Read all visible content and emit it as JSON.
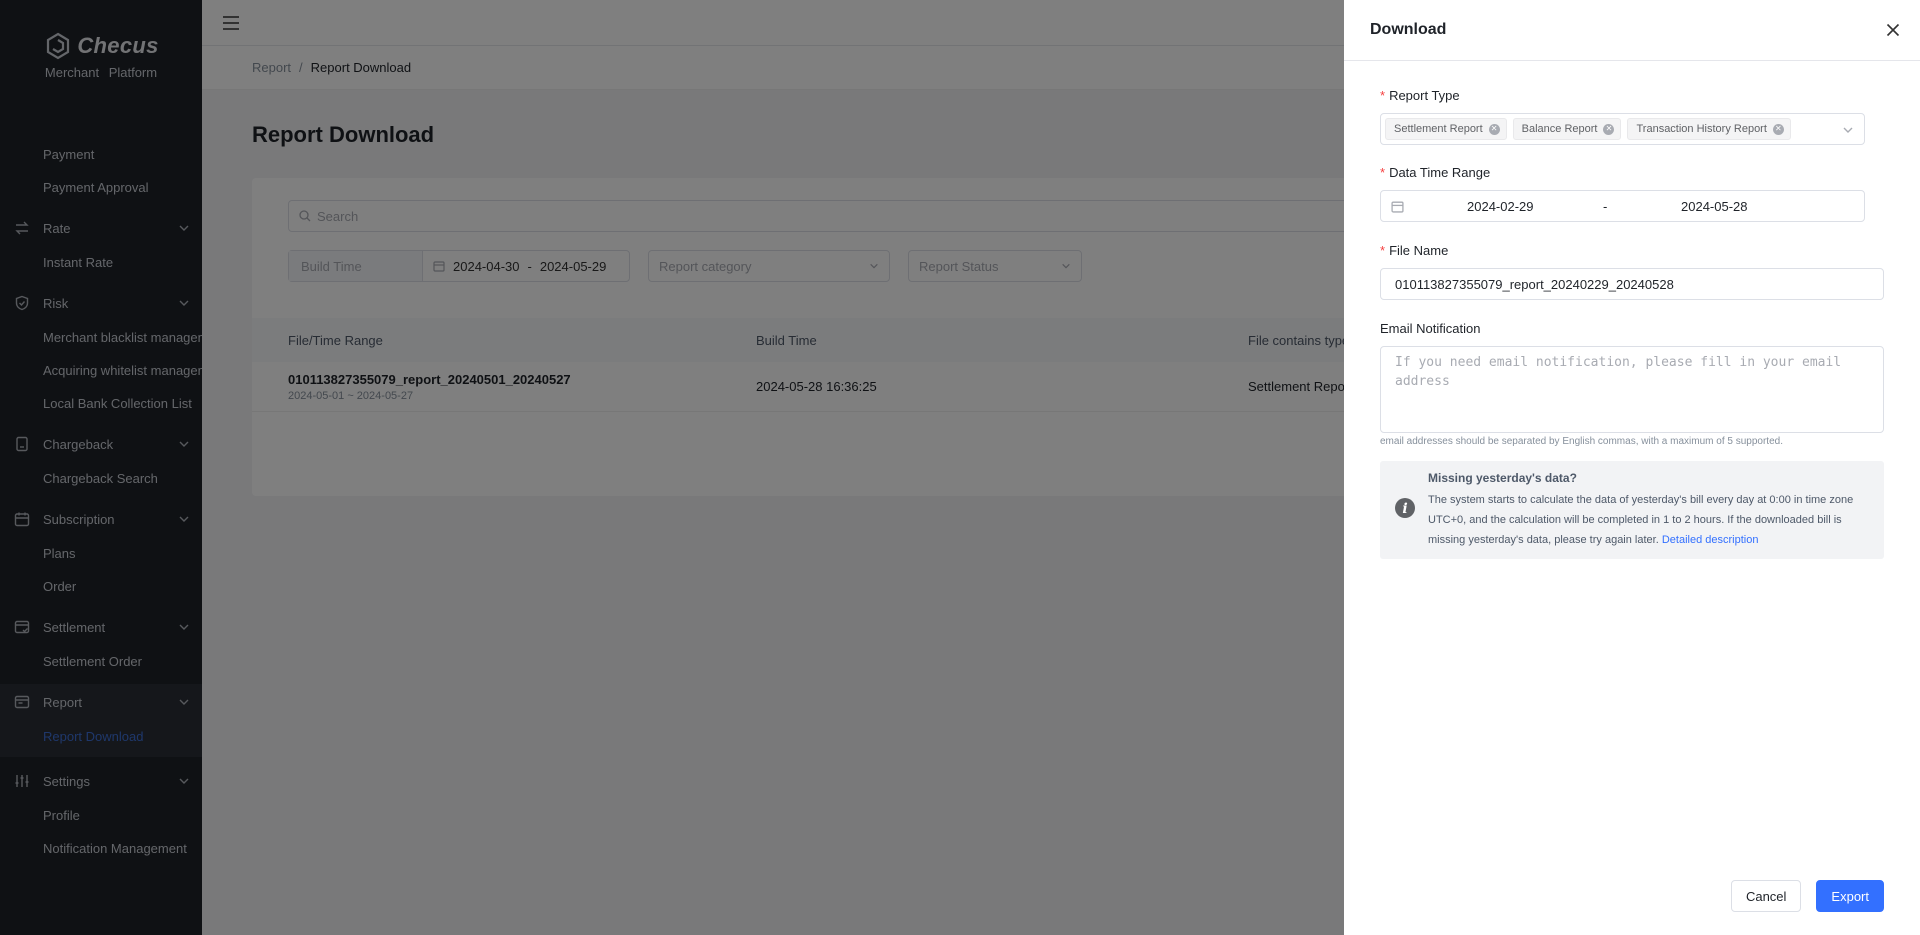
{
  "brand": {
    "name": "Checus",
    "subtitle": "Merchant  Platform"
  },
  "sidebar": {
    "items": [
      {
        "label": "Payment"
      },
      {
        "label": "Payment Approval"
      },
      {
        "label": "Rate"
      },
      {
        "label": "Instant Rate"
      },
      {
        "label": "Risk"
      },
      {
        "label": "Merchant blacklist management"
      },
      {
        "label": "Acquiring whitelist management"
      },
      {
        "label": "Local Bank Collection List"
      },
      {
        "label": "Chargeback"
      },
      {
        "label": "Chargeback Search"
      },
      {
        "label": "Subscription"
      },
      {
        "label": "Plans"
      },
      {
        "label": "Order"
      },
      {
        "label": "Settlement"
      },
      {
        "label": "Settlement Order"
      },
      {
        "label": "Report"
      },
      {
        "label": "Report Download"
      },
      {
        "label": "Settings"
      },
      {
        "label": "Profile"
      },
      {
        "label": "Notification Management"
      }
    ]
  },
  "breadcrumb": {
    "parent": "Report",
    "separator": "/",
    "current": "Report Download"
  },
  "page": {
    "title": "Report Download"
  },
  "filters": {
    "search_placeholder": "Search",
    "build_time_label": "Build Time",
    "build_time_start": "2024-04-30",
    "build_time_sep": "-",
    "build_time_end": "2024-05-29",
    "category_placeholder": "Report category",
    "status_placeholder": "Report Status"
  },
  "table": {
    "headers": [
      "File/Time Range",
      "Build Time",
      "File contains type"
    ],
    "rows": [
      {
        "file": "010113827355079_report_20240501_20240527",
        "range": "2024-05-01 ~ 2024-05-27",
        "build_time": "2024-05-28 16:36:25",
        "types": "Settlement Repo"
      }
    ]
  },
  "drawer": {
    "title": "Download",
    "report_type_label": "Report Type",
    "report_types": [
      "Settlement Report",
      "Balance Report",
      "Transaction History Report"
    ],
    "date_range_label": "Data Time Range",
    "date_start": "2024-02-29",
    "date_sep": "-",
    "date_end": "2024-05-28",
    "file_name_label": "File Name",
    "file_name": "010113827355079_report_20240229_20240528",
    "email_label": "Email Notification",
    "email_placeholder": "If you need email notification, please fill in your email address",
    "email_hint": "email addresses should be separated by English commas, with a maximum of 5 supported.",
    "info_title": "Missing yesterday's data?",
    "info_text": "The system starts to calculate the data of yesterday's bill every day at 0:00 in time zone UTC+0, and the calculation will be completed in 1 to 2 hours. If the downloaded bill is missing yesterday's data, please try again later.",
    "info_link": "Detailed description",
    "cancel_label": "Cancel",
    "export_label": "Export"
  },
  "colors": {
    "primary": "#3370ff",
    "sidebar_bg": "#1f2329",
    "required": "#f53f3f",
    "active_link": "#3d6fd6"
  }
}
